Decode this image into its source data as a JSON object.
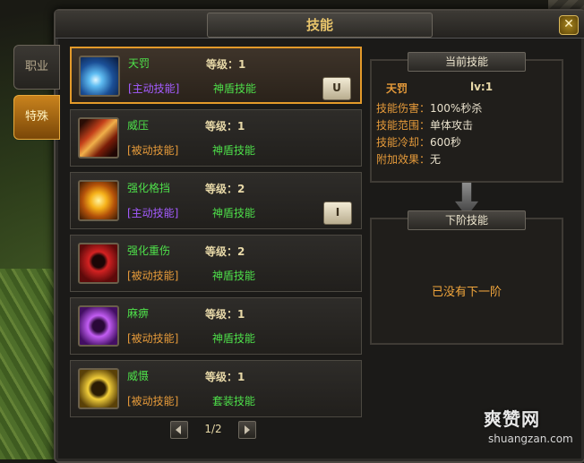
{
  "window": {
    "title": "技能",
    "close_label": "✕"
  },
  "tabs": [
    {
      "label": "职业",
      "active": false
    },
    {
      "label": "特殊",
      "active": true
    }
  ],
  "skills": [
    {
      "name": "天罚",
      "level": "等级：1",
      "type": "[主动技能]",
      "category": "神盾技能",
      "hotkey": "U",
      "icon": "divine-punishment-icon",
      "selected": true
    },
    {
      "name": "威压",
      "level": "等级：1",
      "type": "[被动技能]",
      "category": "神盾技能",
      "hotkey": "",
      "icon": "coercion-icon",
      "selected": false
    },
    {
      "name": "强化格挡",
      "level": "等级：2",
      "type": "[主动技能]",
      "category": "神盾技能",
      "hotkey": "I",
      "icon": "enhanced-block-icon",
      "selected": false
    },
    {
      "name": "强化重伤",
      "level": "等级：2",
      "type": "[被动技能]",
      "category": "神盾技能",
      "hotkey": "",
      "icon": "enhanced-wound-icon",
      "selected": false
    },
    {
      "name": "麻痹",
      "level": "等级：1",
      "type": "[被动技能]",
      "category": "神盾技能",
      "hotkey": "",
      "icon": "paralysis-icon",
      "selected": false
    },
    {
      "name": "威慑",
      "level": "等级：1",
      "type": "[被动技能]",
      "category": "套装技能",
      "hotkey": "",
      "icon": "deterrence-icon",
      "selected": false
    }
  ],
  "pager": {
    "text": "1/2"
  },
  "current_skill": {
    "header": "当前技能",
    "name": "天罚",
    "level": "lv:1",
    "attrs": [
      {
        "key": "技能伤害：",
        "value": "100%秒杀"
      },
      {
        "key": "技能范围：",
        "value": "单体攻击"
      },
      {
        "key": "技能冷却：",
        "value": "600秒"
      },
      {
        "key": "附加效果：",
        "value": "无"
      }
    ]
  },
  "next_skill": {
    "header": "下阶技能",
    "message": "已没有下一阶"
  },
  "watermark": {
    "main": "爽赞网",
    "sub": "shuangzan.com"
  }
}
